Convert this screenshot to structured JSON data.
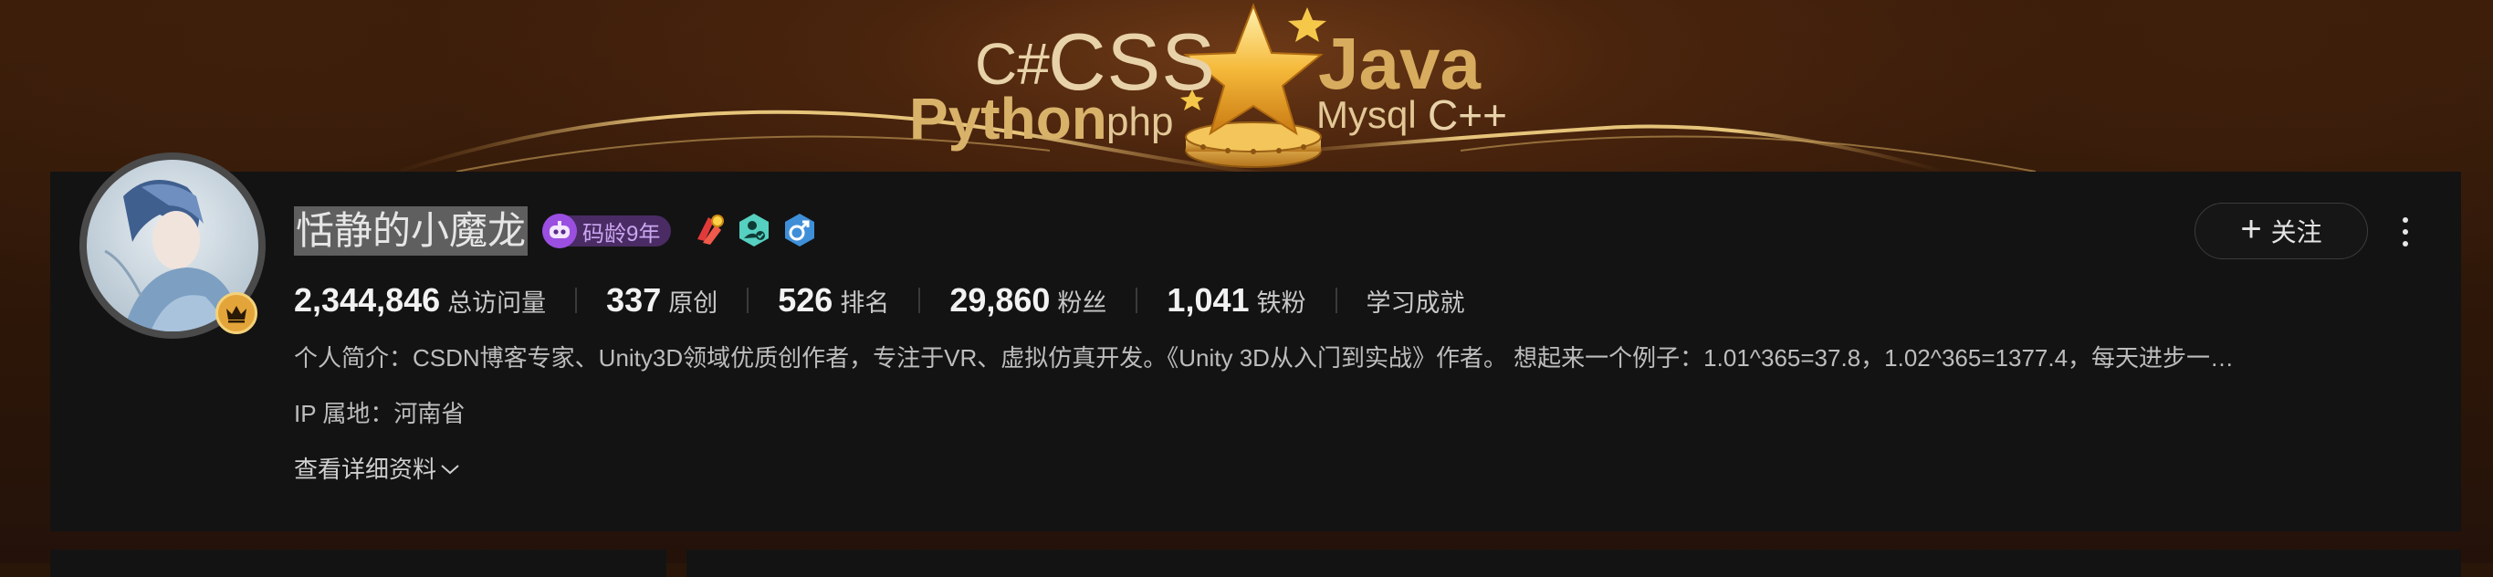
{
  "banner": {
    "words": {
      "csharp": "C#",
      "css": "CSS",
      "java": "Java",
      "python": "Python",
      "php": "php",
      "mysql": "Mysql",
      "cpp": "C++"
    }
  },
  "profile": {
    "name": "恬静的小魔龙",
    "code_age_badge": "码龄9年",
    "follow_label": "关注",
    "stats": [
      {
        "value": "2,344,846",
        "label": "总访问量"
      },
      {
        "value": "337",
        "label": "原创"
      },
      {
        "value": "526",
        "label": "排名"
      },
      {
        "value": "29,860",
        "label": "粉丝"
      },
      {
        "value": "1,041",
        "label": "铁粉"
      }
    ],
    "achievement_label": "学习成就",
    "bio": "个人简介：CSDN博客专家、Unity3D领域优质创作者，专注于VR、虚拟仿真开发。《Unity 3D从入门到实战》作者。 想起来一个例子：1.01^365=37.8，1.02^365=1377.4，每天进步一…",
    "ip_location": "IP 属地：河南省",
    "details_label": "查看详细资料"
  },
  "icons": {
    "avatar_badge": "crown-icon",
    "badge1": "red-medal-icon",
    "badge2": "user-check-icon",
    "badge3": "gender-male-icon",
    "follow": "plus-icon",
    "more": "more-vertical-icon",
    "details": "chevron-down-icon"
  },
  "colors": {
    "card_bg": "#131313",
    "banner_gold": "#d9b26a",
    "badge_purple": "#9b4fe0"
  }
}
